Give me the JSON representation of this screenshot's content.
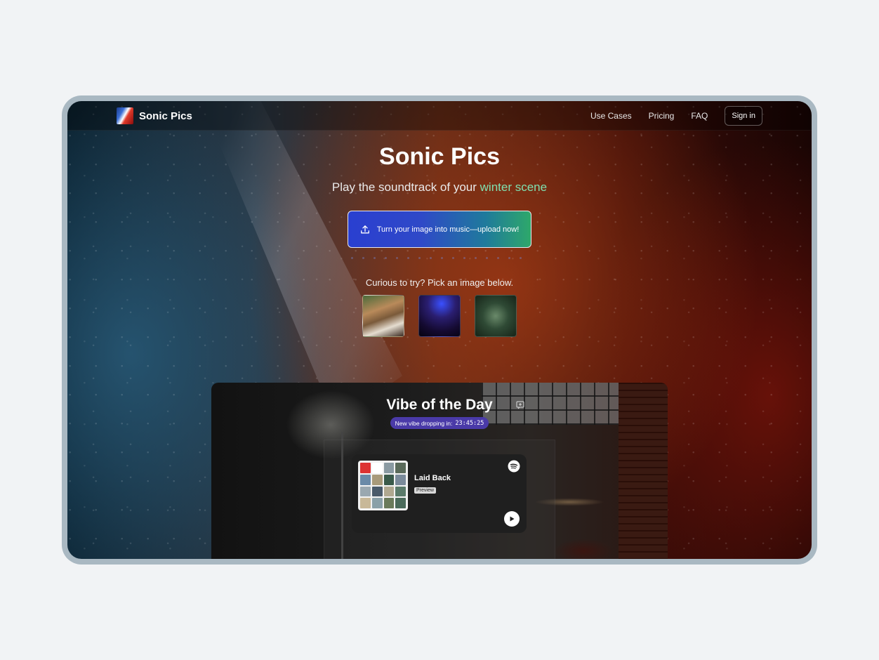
{
  "app": {
    "brand": "Sonic Pics"
  },
  "nav": {
    "links": [
      "Use Cases",
      "Pricing",
      "FAQ"
    ],
    "signin": "Sign in"
  },
  "hero": {
    "title": "Sonic Pics",
    "subtitle_prefix": "Play the soundtrack of your",
    "subtitle_accent": "winter scene",
    "accent_color": "#7fe0b0",
    "upload_label": "Turn your image into music—upload now!",
    "try_label": "Curious to try? Pick an image below."
  },
  "samples": [
    {
      "icon": "desk-photo"
    },
    {
      "icon": "concert-photo"
    },
    {
      "icon": "forest-photo"
    }
  ],
  "vibe": {
    "title": "Vibe of the Day",
    "countdown_label": "New vibe dropping in:",
    "countdown_time": "23:45:25",
    "track": {
      "title": "Laid Back",
      "badge": "Preview"
    }
  },
  "colors": {
    "countdown_bg": "#4a3aa8",
    "card_bg": "#1f1f1f"
  }
}
